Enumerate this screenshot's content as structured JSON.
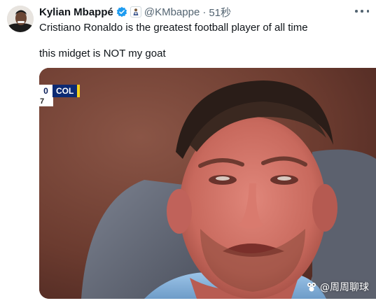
{
  "tweet": {
    "display_name": "Kylian Mbappé",
    "handle": "@KMbappe",
    "separator": "·",
    "time": "51秒",
    "verified_icon": "verified-badge-icon",
    "affiliation_icon": "affiliation-badge-icon",
    "more_icon": "more-options-icon",
    "text_line1": "Cristiano Ronaldo is the greatest football player of all time",
    "text_line2": "this midget is NOT my goat"
  },
  "media": {
    "scoreboard": {
      "score": "0",
      "team": "COL",
      "minute": "7",
      "team_color": "#0c2a73",
      "accent_color": "#f4d31b"
    },
    "watermark": "@周周聊球"
  },
  "colors": {
    "text": "#0f1419",
    "secondary": "#536471",
    "verified": "#1d9bf0"
  }
}
